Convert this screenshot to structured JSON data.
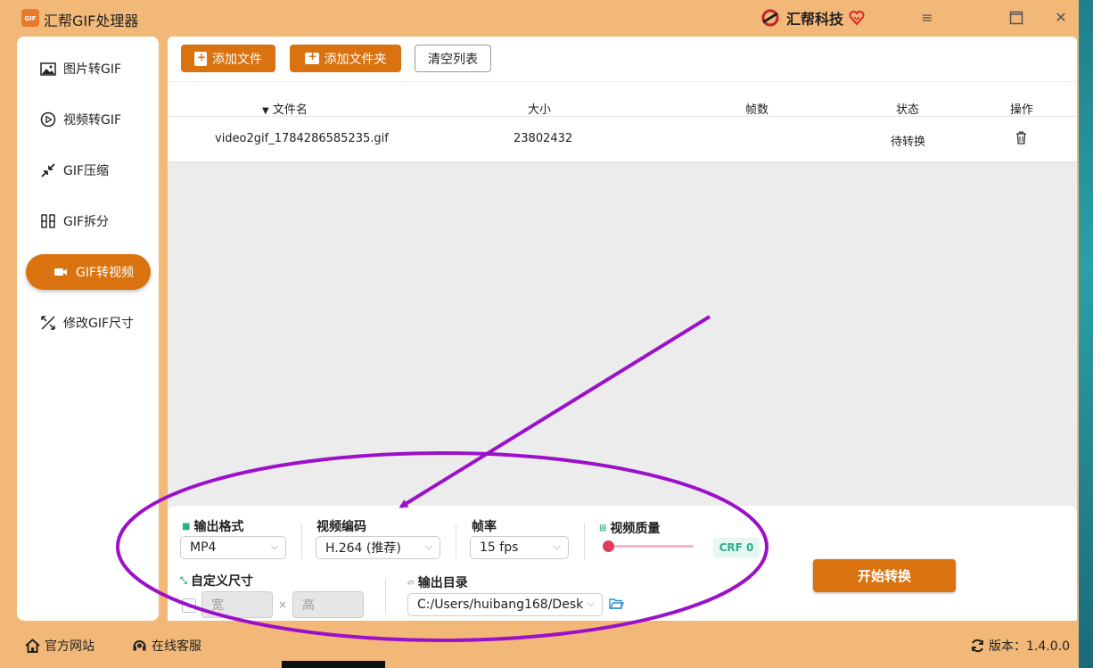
{
  "window": {
    "title": "汇帮GIF处理器",
    "logo_text": "GIF",
    "brand": "汇帮科技"
  },
  "sidebar": {
    "items": [
      {
        "label": "图片转GIF",
        "icon": "image-icon"
      },
      {
        "label": "视频转GIF",
        "icon": "play-circle-icon"
      },
      {
        "label": "GIF压缩",
        "icon": "compress-arrows-icon"
      },
      {
        "label": "GIF拆分",
        "icon": "split-icon"
      },
      {
        "label": "GIF转视频",
        "icon": "video-camera-icon",
        "active": true
      },
      {
        "label": "修改GIF尺寸",
        "icon": "resize-icon"
      }
    ]
  },
  "toolbar": {
    "add_file": "添加文件",
    "add_folder": "添加文件夹",
    "clear_list": "清空列表"
  },
  "table": {
    "headers": {
      "name": "文件名",
      "size": "大小",
      "frames": "帧数",
      "status": "状态",
      "action": "操作"
    },
    "rows": [
      {
        "name": "video2gif_1784286585235.gif",
        "size": "23802432",
        "frames": "",
        "status": "待转换"
      }
    ]
  },
  "settings": {
    "output_format": {
      "label": "输出格式",
      "value": "MP4"
    },
    "video_codec": {
      "label": "视频编码",
      "value": "H.264 (推荐)"
    },
    "frame_rate": {
      "label": "帧率",
      "value": "15 fps"
    },
    "quality": {
      "label": "视频质量",
      "value": 0,
      "badge": "CRF 0"
    },
    "custom_size": {
      "label": "自定义尺寸",
      "width_placeholder": "宽",
      "height_placeholder": "高",
      "times": "×"
    },
    "output_dir": {
      "label": "输出目录",
      "value": "C:/Users/huibang168/Desk"
    },
    "start_button": "开始转换"
  },
  "statusbar": {
    "website": "官方网站",
    "support": "在线客服",
    "version": "版本：1.4.0.0"
  },
  "colors": {
    "accent": "#d9720f",
    "window_bg": "#f2b877",
    "annotation": "#9b10c9",
    "quality_badge": "#27b08a"
  }
}
